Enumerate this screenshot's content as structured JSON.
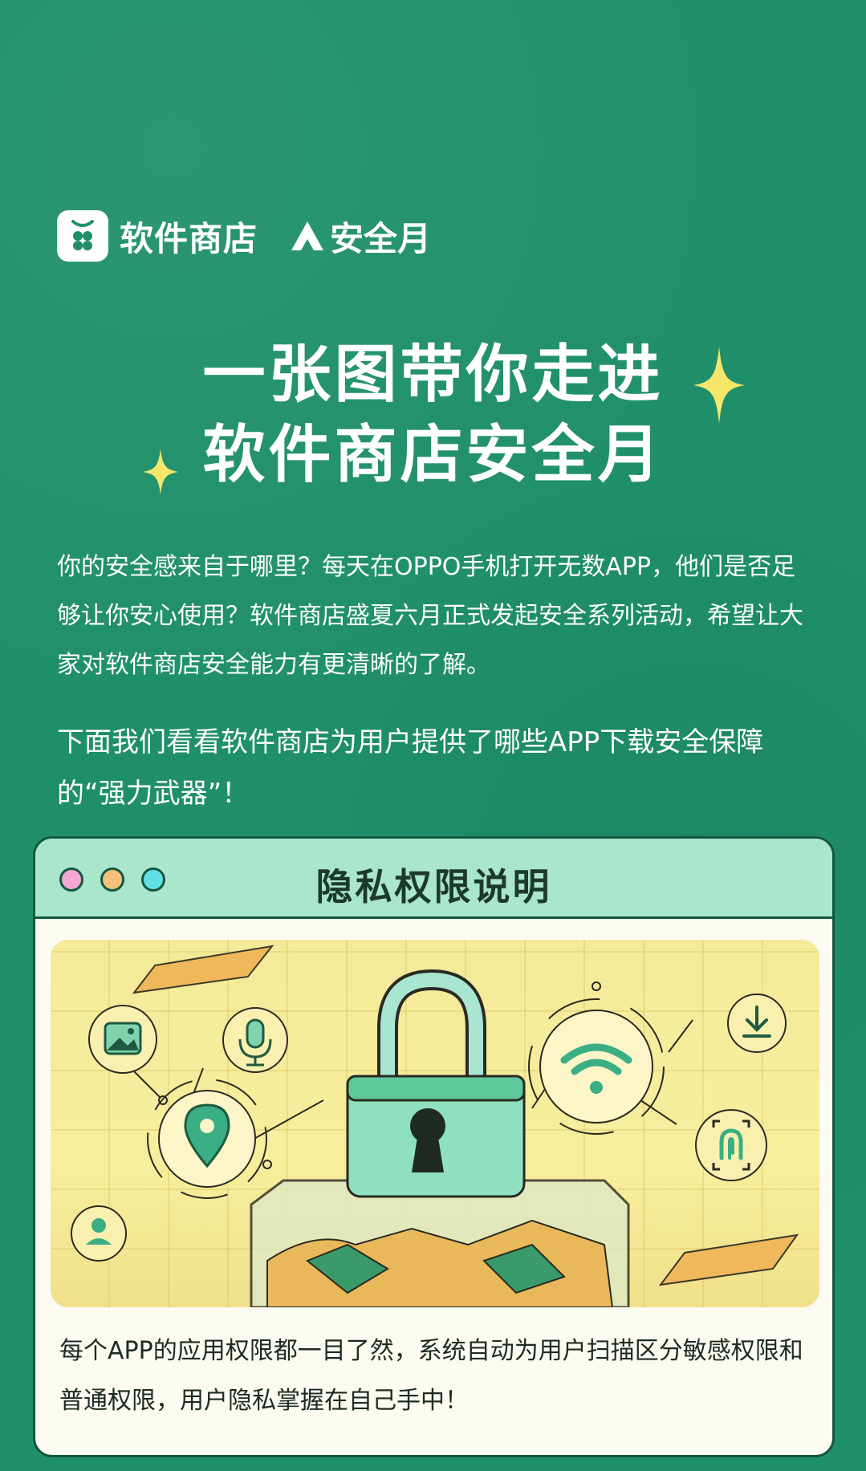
{
  "brand": {
    "app_name": "软件商店",
    "campaign_name": "安全月"
  },
  "headline": {
    "line1": "一张图带你走进",
    "line2": "软件商店安全月"
  },
  "intro": {
    "paragraph1": "你的安全感来自于哪里？每天在OPPO手机打开无数APP，他们是否足够让你安心使用？软件商店盛夏六月正式发起安全系列活动，希望让大家对软件商店安全能力有更清晰的了解。",
    "paragraph2": "下面我们看看软件商店为用户提供了哪些APP下载安全保障的“强力武器”！"
  },
  "card": {
    "title": "隐私权限说明",
    "description": "每个APP的应用权限都一目了然，系统自动为用户扫描区分敏感权限和普通权限，用户隐私掌握在自己手中！"
  },
  "icons": [
    "store-logo-icon",
    "triangle-logo-icon",
    "sparkle-icon",
    "padlock-icon",
    "image-icon",
    "microphone-icon",
    "location-icon",
    "contact-icon",
    "wifi-icon",
    "download-icon",
    "fingerprint-icon"
  ],
  "colors": {
    "background": "#1f8f6a",
    "card_header": "#a9e6cc",
    "sparkle": "#f6e66a",
    "illustration_bg": "#f4ea9a",
    "lock_body": "#8fe0be"
  }
}
